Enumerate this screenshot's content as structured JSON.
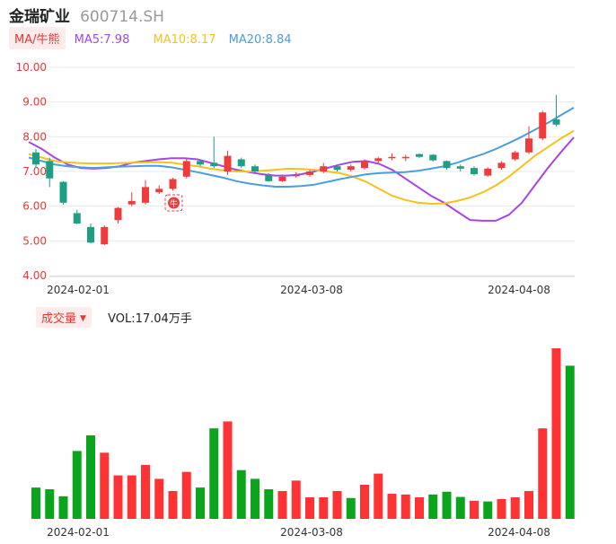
{
  "header": {
    "stock_name": "金瑞矿业",
    "stock_code": "600714.SH"
  },
  "ma_legend": {
    "toggle_label": "MA/牛熊",
    "ma5": "MA5:7.98",
    "ma10": "MA10:8.17",
    "ma20": "MA20:8.84"
  },
  "volume_legend": {
    "toggle_label": "成交量",
    "caret": "▼",
    "value_text": "VOL:17.04万手"
  },
  "badge_label": "牛",
  "colors": {
    "up": "#ef3b3b",
    "down": "#1c9f84",
    "vol_up": "#ff3333",
    "vol_down": "#0aa51d",
    "ma5": "#a545e6",
    "ma10": "#f5c21a",
    "ma20": "#4a9de0",
    "tick_price": "#e53935",
    "tick_date": "#333333",
    "grid": "#e9e9e9"
  },
  "chart_data": [
    {
      "type": "candlestick",
      "title": "",
      "y_ticks": [
        "4.00",
        "5.00",
        "6.00",
        "7.00",
        "8.00",
        "9.00",
        "10.00"
      ],
      "ylim": [
        4.0,
        10.0
      ],
      "x_ticks": [
        "2024-02-01",
        "2024-03-08",
        "2024-04-08"
      ],
      "grid": true,
      "candles": [
        {
          "o": 7.55,
          "c": 7.2,
          "h": 7.65,
          "l": 7.1
        },
        {
          "o": 7.3,
          "c": 6.8,
          "h": 7.4,
          "l": 6.55
        },
        {
          "o": 6.7,
          "c": 6.1,
          "h": 6.72,
          "l": 6.05
        },
        {
          "o": 5.8,
          "c": 5.5,
          "h": 5.9,
          "l": 5.48
        },
        {
          "o": 5.4,
          "c": 4.95,
          "h": 5.5,
          "l": 4.93
        },
        {
          "o": 4.9,
          "c": 5.4,
          "h": 5.45,
          "l": 4.88
        },
        {
          "o": 5.6,
          "c": 5.95,
          "h": 5.98,
          "l": 5.5
        },
        {
          "o": 6.05,
          "c": 6.15,
          "h": 6.4,
          "l": 6.0
        },
        {
          "o": 6.1,
          "c": 6.55,
          "h": 6.75,
          "l": 6.05
        },
        {
          "o": 6.4,
          "c": 6.5,
          "h": 6.6,
          "l": 6.35
        },
        {
          "o": 6.5,
          "c": 6.78,
          "h": 6.82,
          "l": 6.45
        },
        {
          "o": 6.85,
          "c": 7.3,
          "h": 7.35,
          "l": 6.8
        },
        {
          "o": 7.3,
          "c": 7.2,
          "h": 7.35,
          "l": 7.15
        },
        {
          "o": 7.25,
          "c": 7.15,
          "h": 8.0,
          "l": 7.1
        },
        {
          "o": 7.0,
          "c": 7.45,
          "h": 7.6,
          "l": 6.9
        },
        {
          "o": 7.35,
          "c": 7.15,
          "h": 7.4,
          "l": 7.1
        },
        {
          "o": 7.15,
          "c": 7.0,
          "h": 7.2,
          "l": 6.95
        },
        {
          "o": 6.9,
          "c": 6.72,
          "h": 6.95,
          "l": 6.7
        },
        {
          "o": 6.72,
          "c": 6.85,
          "h": 6.9,
          "l": 6.7
        },
        {
          "o": 6.88,
          "c": 6.9,
          "h": 6.98,
          "l": 6.82
        },
        {
          "o": 6.9,
          "c": 7.0,
          "h": 7.05,
          "l": 6.85
        },
        {
          "o": 7.0,
          "c": 7.15,
          "h": 7.25,
          "l": 6.95
        },
        {
          "o": 7.15,
          "c": 7.05,
          "h": 7.2,
          "l": 7.0
        },
        {
          "o": 7.05,
          "c": 7.15,
          "h": 7.2,
          "l": 7.0
        },
        {
          "o": 7.1,
          "c": 7.3,
          "h": 7.35,
          "l": 7.05
        },
        {
          "o": 7.3,
          "c": 7.38,
          "h": 7.42,
          "l": 7.25
        },
        {
          "o": 7.38,
          "c": 7.42,
          "h": 7.52,
          "l": 7.32
        },
        {
          "o": 7.38,
          "c": 7.42,
          "h": 7.48,
          "l": 7.3
        },
        {
          "o": 7.5,
          "c": 7.42,
          "h": 7.52,
          "l": 7.38
        },
        {
          "o": 7.48,
          "c": 7.32,
          "h": 7.5,
          "l": 7.28
        },
        {
          "o": 7.3,
          "c": 7.1,
          "h": 7.32,
          "l": 7.05
        },
        {
          "o": 7.15,
          "c": 7.08,
          "h": 7.2,
          "l": 7.0
        },
        {
          "o": 7.1,
          "c": 6.92,
          "h": 7.15,
          "l": 6.88
        },
        {
          "o": 6.88,
          "c": 7.08,
          "h": 7.12,
          "l": 6.85
        },
        {
          "o": 7.1,
          "c": 7.25,
          "h": 7.3,
          "l": 7.05
        },
        {
          "o": 7.35,
          "c": 7.55,
          "h": 7.6,
          "l": 7.3
        },
        {
          "o": 7.55,
          "c": 7.95,
          "h": 8.3,
          "l": 7.5
        },
        {
          "o": 7.95,
          "c": 8.7,
          "h": 8.75,
          "l": 7.9
        },
        {
          "o": 8.5,
          "c": 8.35,
          "h": 9.2,
          "l": 8.3
        }
      ],
      "series": [
        {
          "name": "MA5",
          "values": [
            7.85,
            7.65,
            7.4,
            7.2,
            7.1,
            7.08,
            7.1,
            7.15,
            7.25,
            7.3,
            7.35,
            7.38,
            7.38,
            7.35,
            7.25,
            7.15,
            7.05,
            6.98,
            6.92,
            6.88,
            6.88,
            6.92,
            7.0,
            7.1,
            7.2,
            7.28,
            7.3,
            7.22,
            7.05,
            6.8,
            6.55,
            6.3,
            6.1,
            5.85,
            5.6,
            5.58,
            5.58,
            5.75,
            6.1,
            6.6,
            7.1,
            7.55,
            7.98
          ]
        },
        {
          "name": "MA10",
          "values": [
            7.5,
            7.4,
            7.3,
            7.26,
            7.24,
            7.23,
            7.23,
            7.24,
            7.25,
            7.26,
            7.27,
            7.25,
            7.2,
            7.15,
            7.08,
            7.03,
            7.0,
            7.0,
            7.02,
            7.05,
            7.08,
            7.07,
            7.05,
            7.0,
            6.95,
            6.85,
            6.7,
            6.5,
            6.3,
            6.18,
            6.1,
            6.07,
            6.08,
            6.15,
            6.25,
            6.4,
            6.6,
            6.85,
            7.15,
            7.45,
            7.7,
            7.95,
            8.17
          ]
        },
        {
          "name": "MA20",
          "values": [
            7.4,
            7.3,
            7.2,
            7.15,
            7.12,
            7.1,
            7.12,
            7.14,
            7.15,
            7.16,
            7.16,
            7.12,
            7.05,
            6.98,
            6.9,
            6.82,
            6.72,
            6.65,
            6.6,
            6.56,
            6.56,
            6.58,
            6.62,
            6.7,
            6.78,
            6.85,
            6.92,
            6.95,
            6.97,
            6.98,
            7.02,
            7.08,
            7.15,
            7.25,
            7.38,
            7.5,
            7.65,
            7.82,
            8.0,
            8.2,
            8.4,
            8.62,
            8.84
          ]
        }
      ]
    },
    {
      "type": "bar",
      "title": "",
      "x_ticks": [
        "2024-02-01",
        "2024-03-08",
        "2024-04-08"
      ],
      "grid": false,
      "bars": [
        {
          "v": 0.9,
          "dir": "down"
        },
        {
          "v": 0.85,
          "dir": "down"
        },
        {
          "v": 0.65,
          "dir": "down"
        },
        {
          "v": 1.95,
          "dir": "down"
        },
        {
          "v": 2.4,
          "dir": "down"
        },
        {
          "v": 1.9,
          "dir": "up"
        },
        {
          "v": 1.25,
          "dir": "up"
        },
        {
          "v": 1.25,
          "dir": "up"
        },
        {
          "v": 1.55,
          "dir": "up"
        },
        {
          "v": 1.15,
          "dir": "up"
        },
        {
          "v": 0.8,
          "dir": "up"
        },
        {
          "v": 1.35,
          "dir": "up"
        },
        {
          "v": 0.9,
          "dir": "down"
        },
        {
          "v": 2.6,
          "dir": "down"
        },
        {
          "v": 2.8,
          "dir": "up"
        },
        {
          "v": 1.4,
          "dir": "down"
        },
        {
          "v": 1.15,
          "dir": "down"
        },
        {
          "v": 0.85,
          "dir": "down"
        },
        {
          "v": 0.8,
          "dir": "up"
        },
        {
          "v": 1.1,
          "dir": "up"
        },
        {
          "v": 0.62,
          "dir": "up"
        },
        {
          "v": 0.62,
          "dir": "up"
        },
        {
          "v": 0.8,
          "dir": "up"
        },
        {
          "v": 0.6,
          "dir": "down"
        },
        {
          "v": 0.98,
          "dir": "up"
        },
        {
          "v": 1.3,
          "dir": "up"
        },
        {
          "v": 0.72,
          "dir": "up"
        },
        {
          "v": 0.7,
          "dir": "up"
        },
        {
          "v": 0.62,
          "dir": "up"
        },
        {
          "v": 0.7,
          "dir": "down"
        },
        {
          "v": 0.78,
          "dir": "down"
        },
        {
          "v": 0.63,
          "dir": "down"
        },
        {
          "v": 0.52,
          "dir": "up"
        },
        {
          "v": 0.5,
          "dir": "down"
        },
        {
          "v": 0.57,
          "dir": "up"
        },
        {
          "v": 0.62,
          "dir": "up"
        },
        {
          "v": 0.8,
          "dir": "up"
        },
        {
          "v": 2.6,
          "dir": "up"
        },
        {
          "v": 4.9,
          "dir": "up"
        },
        {
          "v": 4.4,
          "dir": "down"
        }
      ]
    }
  ]
}
